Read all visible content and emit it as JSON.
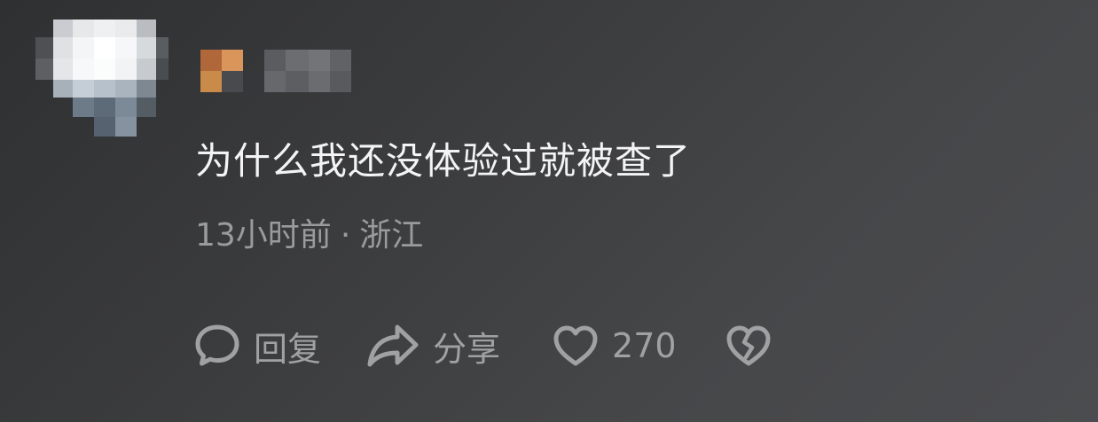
{
  "comment": {
    "text": "为什么我还没体验过就被查了",
    "time": "13小时前",
    "separator": "·",
    "location": "浙江"
  },
  "actions": {
    "reply_label": "回复",
    "share_label": "分享",
    "like_count": "270"
  },
  "icons": {
    "reply": "speech-bubble-icon",
    "share": "share-arrow-icon",
    "like": "heart-icon",
    "dislike": "broken-heart-icon"
  },
  "colors": {
    "background": "#3a3b3d",
    "text": "#f4f4f4",
    "meta": "#9a9b9d",
    "action": "#a0a1a3",
    "badge_orange": "#c98a4a"
  }
}
